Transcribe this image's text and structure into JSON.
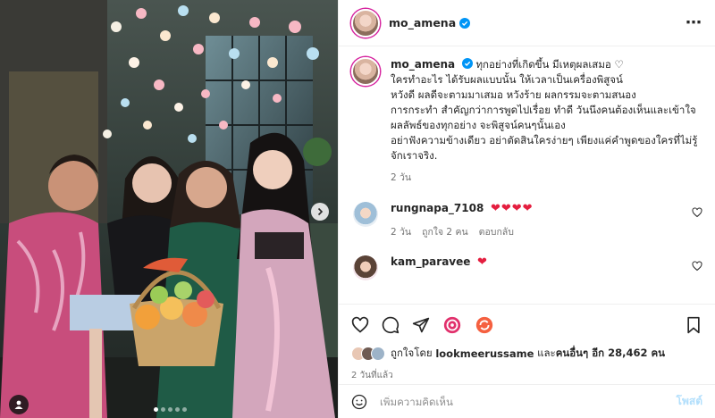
{
  "post": {
    "username": "mo_amena",
    "verified": true,
    "more_icon": "more-horizontal-icon"
  },
  "caption": {
    "username": "mo_amena",
    "line1": "ทุกอย่างที่เกิดขึ้น มีเหตุผลเสมอ ♡",
    "lines_a": [
      "ใครทำอะไร ได้รับผลแบบนั้น ให้เวลาเป็นเครื่องพิสูจน์",
      "หวังดี ผลดีจะตามมาเสมอ หวังร้าย ผลกรรมจะตามสนอง",
      "การกระทำ สำคัญกว่าการพูดไปเรื่อย ทำดี วันนึงคนต้องเห็นและเข้าใจ"
    ],
    "line_b": "ผลลัพธ์ของทุกอย่าง จะพิสูจน์คนๆนั้นเอง",
    "lines_c": [
      "อย่าฟังความข้างเดียว อย่าตัดสินใครง่ายๆ เพียงแค่คำพูดของใครที่ไม่รู้",
      "จักเราจริง."
    ],
    "time": "2 วัน"
  },
  "comments": [
    {
      "username": "rungnapa_7108",
      "text": "❤❤❤❤",
      "time": "2 วัน",
      "likes": "ถูกใจ 2 คน",
      "reply": "ตอบกลับ"
    },
    {
      "username": "kam_paravee",
      "text": "❤"
    }
  ],
  "actions": {
    "like_icon": "heart-icon",
    "comment_icon": "comment-icon",
    "share_icon": "share-icon",
    "save_icon": "bookmark-icon"
  },
  "likes": {
    "prefix": "ถูกใจโดย",
    "user": "lookmeerussame",
    "middle": "และ",
    "others": "คนอื่นๆ อีก 28,462 คน"
  },
  "date": "2 วันที่แล้ว",
  "add_comment": {
    "placeholder": "เพิ่มความคิดเห็น",
    "post_label": "โพสต์"
  },
  "carousel": {
    "count": 5,
    "active": 0
  }
}
